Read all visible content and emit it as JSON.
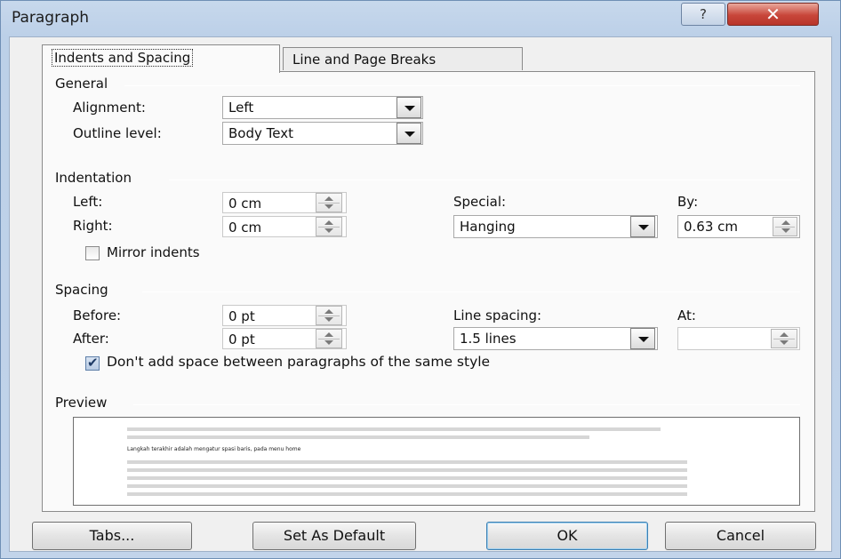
{
  "window": {
    "title": "Paragraph",
    "help_label": "?",
    "close_label": "✕"
  },
  "tabs": [
    {
      "label": "Indents and Spacing",
      "active": true
    },
    {
      "label": "Line and Page Breaks",
      "active": false
    }
  ],
  "general": {
    "title": "General",
    "alignment": {
      "label": "Alignment:",
      "value": "Left"
    },
    "outline_level": {
      "label": "Outline level:",
      "value": "Body Text"
    }
  },
  "indentation": {
    "title": "Indentation",
    "left": {
      "label": "Left:",
      "value": "0 cm"
    },
    "right": {
      "label": "Right:",
      "value": "0 cm"
    },
    "special": {
      "label": "Special:",
      "value": "Hanging"
    },
    "by": {
      "label": "By:",
      "value": "0.63 cm"
    },
    "mirror": {
      "label": "Mirror indents",
      "checked": false
    }
  },
  "spacing": {
    "title": "Spacing",
    "before": {
      "label": "Before:",
      "value": "0 pt"
    },
    "after": {
      "label": "After:",
      "value": "0 pt"
    },
    "line_spacing": {
      "label": "Line spacing:",
      "value": "1.5 lines"
    },
    "at": {
      "label": "At:",
      "value": ""
    },
    "dont_add": {
      "label": "Don't add space between paragraphs of the same style",
      "checked": true
    }
  },
  "preview": {
    "title": "Preview",
    "sample_text": "Langkah terakhir adalah mengatur spasi baris, pada menu home"
  },
  "buttons": {
    "tabs": "Tabs...",
    "set_default": "Set As Default",
    "ok": "OK",
    "cancel": "Cancel"
  },
  "colors": {
    "accent": "#3c7fb1",
    "close": "#c8463a",
    "chrome": "#c2d4ea"
  }
}
